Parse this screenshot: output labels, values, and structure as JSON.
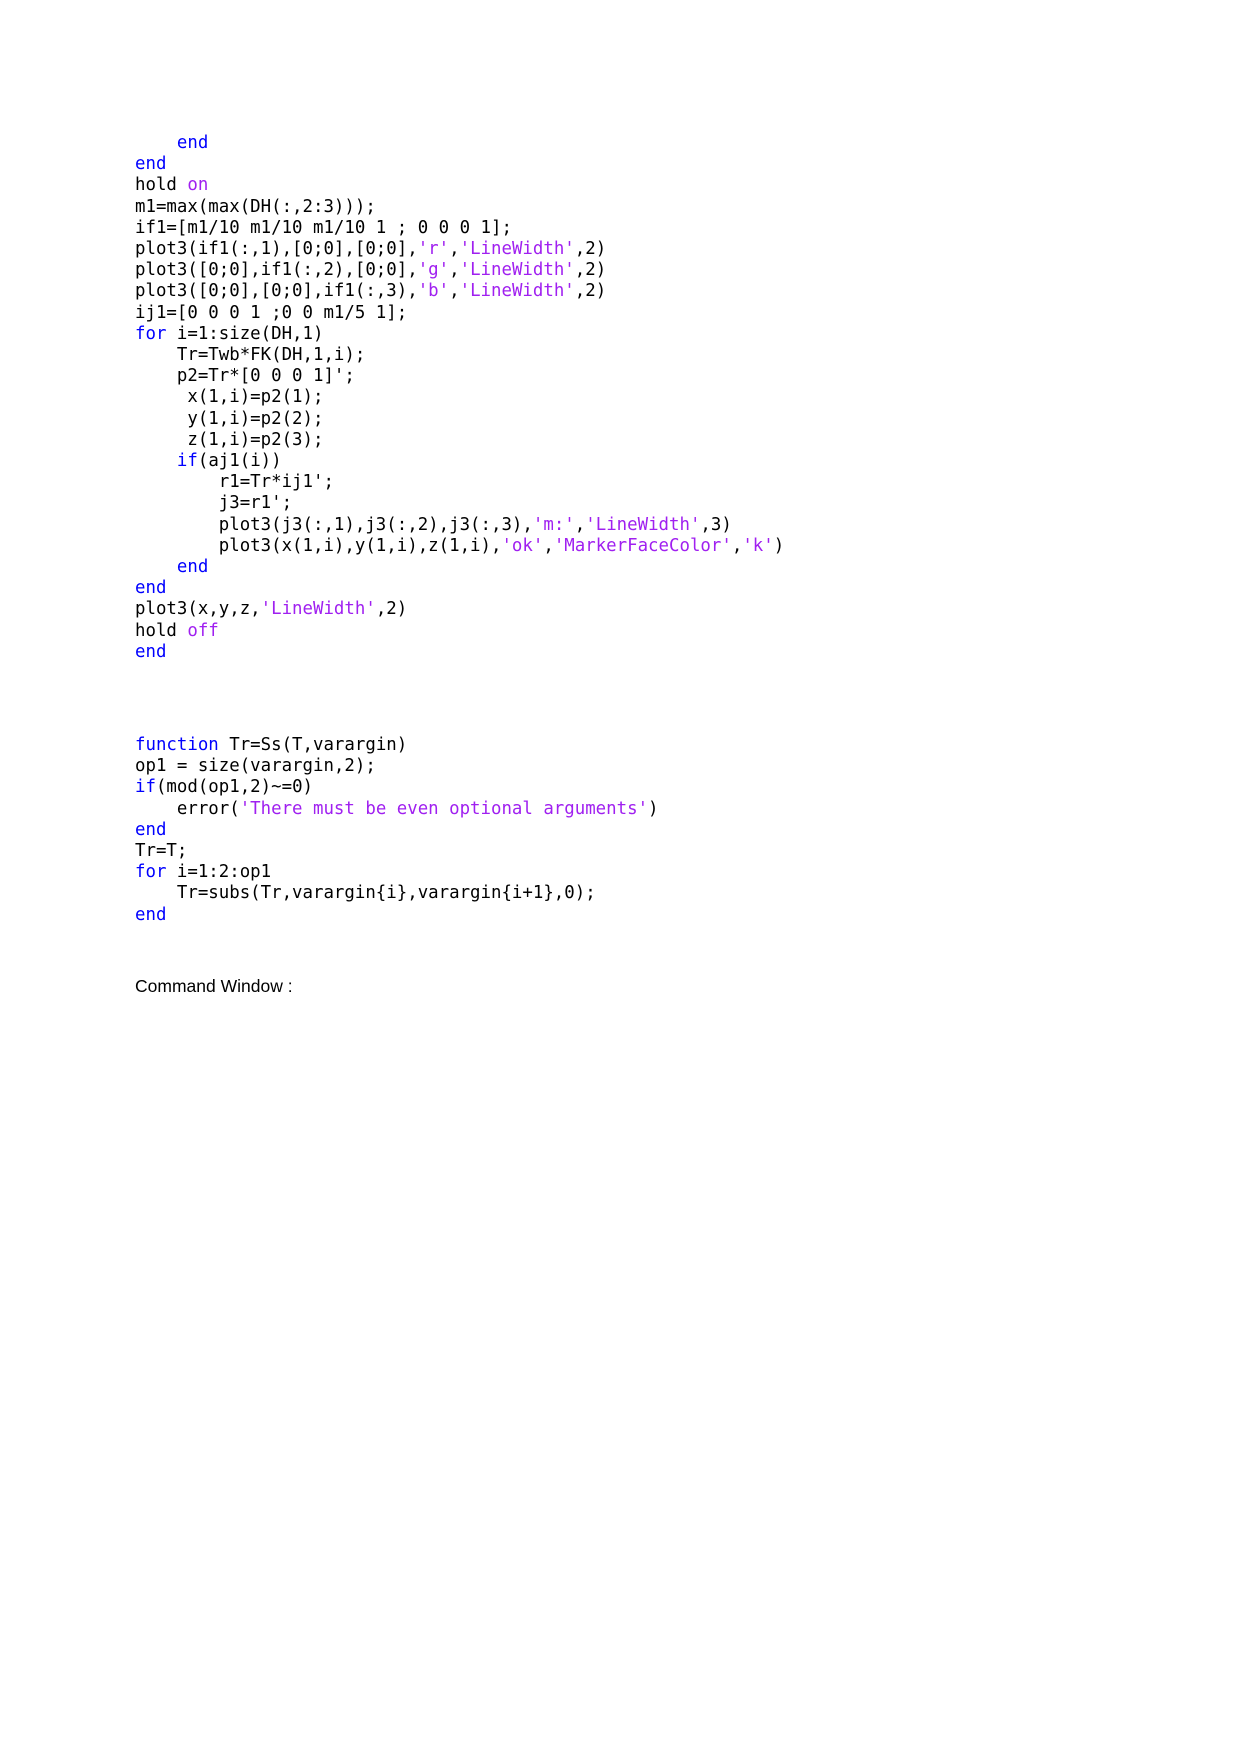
{
  "document": {
    "page_background": "#ffffff",
    "syntax_colors": {
      "keyword": "#0000ff",
      "string": "#a020f0",
      "plain": "#000000"
    }
  },
  "code_listing_main": {
    "lines": [
      [
        {
          "t": "    ",
          "c": "txt"
        },
        {
          "t": "end",
          "c": "kw"
        }
      ],
      [
        {
          "t": "end",
          "c": "kw"
        }
      ],
      [
        {
          "t": "hold ",
          "c": "txt"
        },
        {
          "t": "on",
          "c": "str"
        }
      ],
      [
        {
          "t": "m1=max(max(DH(:,2:3)));",
          "c": "txt"
        }
      ],
      [
        {
          "t": "if1=[m1/10 m1/10 m1/10 1 ; 0 0 0 1];",
          "c": "txt"
        }
      ],
      [
        {
          "t": "plot3(if1(:,1),[0;0],[0;0],",
          "c": "txt"
        },
        {
          "t": "'r'",
          "c": "str"
        },
        {
          "t": ",",
          "c": "txt"
        },
        {
          "t": "'LineWidth'",
          "c": "str"
        },
        {
          "t": ",2)",
          "c": "txt"
        }
      ],
      [
        {
          "t": "plot3([0;0],if1(:,2),[0;0],",
          "c": "txt"
        },
        {
          "t": "'g'",
          "c": "str"
        },
        {
          "t": ",",
          "c": "txt"
        },
        {
          "t": "'LineWidth'",
          "c": "str"
        },
        {
          "t": ",2)",
          "c": "txt"
        }
      ],
      [
        {
          "t": "plot3([0;0],[0;0],if1(:,3),",
          "c": "txt"
        },
        {
          "t": "'b'",
          "c": "str"
        },
        {
          "t": ",",
          "c": "txt"
        },
        {
          "t": "'LineWidth'",
          "c": "str"
        },
        {
          "t": ",2)",
          "c": "txt"
        }
      ],
      [
        {
          "t": "ij1=[0 0 0 1 ;0 0 m1/5 1];",
          "c": "txt"
        }
      ],
      [
        {
          "t": "for",
          "c": "kw"
        },
        {
          "t": " i=1:size(DH,1)",
          "c": "txt"
        }
      ],
      [
        {
          "t": "    Tr=Twb*FK(DH,1,i);",
          "c": "txt"
        }
      ],
      [
        {
          "t": "    p2=Tr*[0 0 0 1]';",
          "c": "txt"
        }
      ],
      [
        {
          "t": "     x(1,i)=p2(1);",
          "c": "txt"
        }
      ],
      [
        {
          "t": "     y(1,i)=p2(2);",
          "c": "txt"
        }
      ],
      [
        {
          "t": "     z(1,i)=p2(3);",
          "c": "txt"
        }
      ],
      [
        {
          "t": "    ",
          "c": "txt"
        },
        {
          "t": "if",
          "c": "kw"
        },
        {
          "t": "(aj1(i))",
          "c": "txt"
        }
      ],
      [
        {
          "t": "        r1=Tr*ij1';",
          "c": "txt"
        }
      ],
      [
        {
          "t": "        j3=r1';",
          "c": "txt"
        }
      ],
      [
        {
          "t": "        plot3(j3(:,1),j3(:,2),j3(:,3),",
          "c": "txt"
        },
        {
          "t": "'m:'",
          "c": "str"
        },
        {
          "t": ",",
          "c": "txt"
        },
        {
          "t": "'LineWidth'",
          "c": "str"
        },
        {
          "t": ",3)",
          "c": "txt"
        }
      ],
      [
        {
          "t": "        plot3(x(1,i),y(1,i),z(1,i),",
          "c": "txt"
        },
        {
          "t": "'ok'",
          "c": "str"
        },
        {
          "t": ",",
          "c": "txt"
        },
        {
          "t": "'MarkerFaceColor'",
          "c": "str"
        },
        {
          "t": ",",
          "c": "txt"
        },
        {
          "t": "'k'",
          "c": "str"
        },
        {
          "t": ")",
          "c": "txt"
        }
      ],
      [
        {
          "t": "    ",
          "c": "txt"
        },
        {
          "t": "end",
          "c": "kw"
        }
      ],
      [
        {
          "t": "end",
          "c": "kw"
        }
      ],
      [
        {
          "t": "plot3(x,y,z,",
          "c": "txt"
        },
        {
          "t": "'LineWidth'",
          "c": "str"
        },
        {
          "t": ",2)",
          "c": "txt"
        }
      ],
      [
        {
          "t": "hold ",
          "c": "txt"
        },
        {
          "t": "off",
          "c": "str"
        }
      ],
      [
        {
          "t": "end",
          "c": "kw"
        }
      ]
    ]
  },
  "code_listing_helper": {
    "lines": [
      [
        {
          "t": "function",
          "c": "kw"
        },
        {
          "t": " Tr=Ss(T,varargin)",
          "c": "txt"
        }
      ],
      [
        {
          "t": "op1 = size(varargin,2);",
          "c": "txt"
        }
      ],
      [
        {
          "t": "if",
          "c": "kw"
        },
        {
          "t": "(mod(op1,2)~=0)",
          "c": "txt"
        }
      ],
      [
        {
          "t": "    error(",
          "c": "txt"
        },
        {
          "t": "'There must be even optional arguments'",
          "c": "str"
        },
        {
          "t": ")",
          "c": "txt"
        }
      ],
      [
        {
          "t": "end",
          "c": "kw"
        }
      ],
      [
        {
          "t": "Tr=T;",
          "c": "txt"
        }
      ],
      [
        {
          "t": "for",
          "c": "kw"
        },
        {
          "t": " i=1:2:op1",
          "c": "txt"
        }
      ],
      [
        {
          "t": "    Tr=subs(Tr,varargin{i},varargin{i+1},0);",
          "c": "txt"
        }
      ],
      [
        {
          "t": "end",
          "c": "kw"
        }
      ]
    ]
  },
  "command_window": {
    "label": "Command Window :"
  }
}
